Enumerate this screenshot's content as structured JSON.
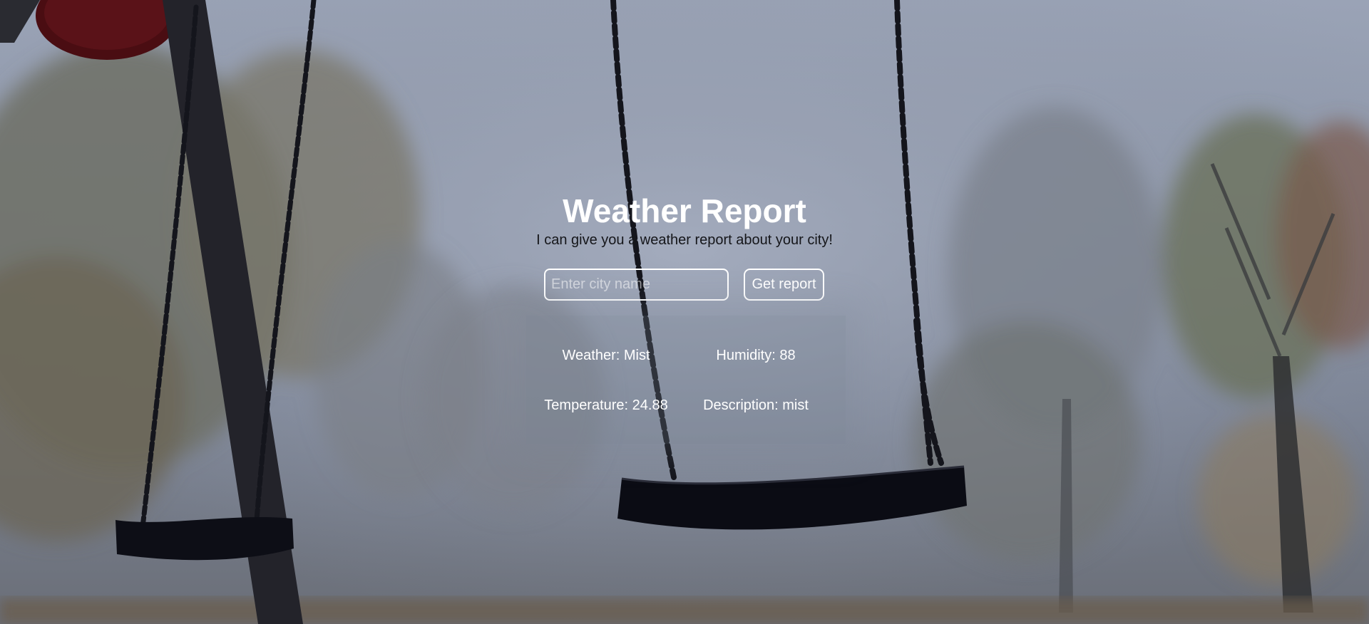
{
  "header": {
    "title": "Weather Report",
    "subtitle": "I can give you a weather report about your city!"
  },
  "search": {
    "placeholder": "Enter city name",
    "value": "",
    "button_label": "Get report"
  },
  "results": {
    "weather": "Weather: Mist",
    "humidity": "Humidity: 88",
    "temperature": "Temperature: 24.88",
    "description": "Description: mist"
  },
  "background": {
    "scene": "foggy playground with swings",
    "colors": {
      "sky": "#9aa3b6",
      "fog": "#8d96a8",
      "swing": "#0b0c14",
      "chain": "#14151c",
      "post": "#23232a",
      "trees": "#6d7264"
    }
  }
}
